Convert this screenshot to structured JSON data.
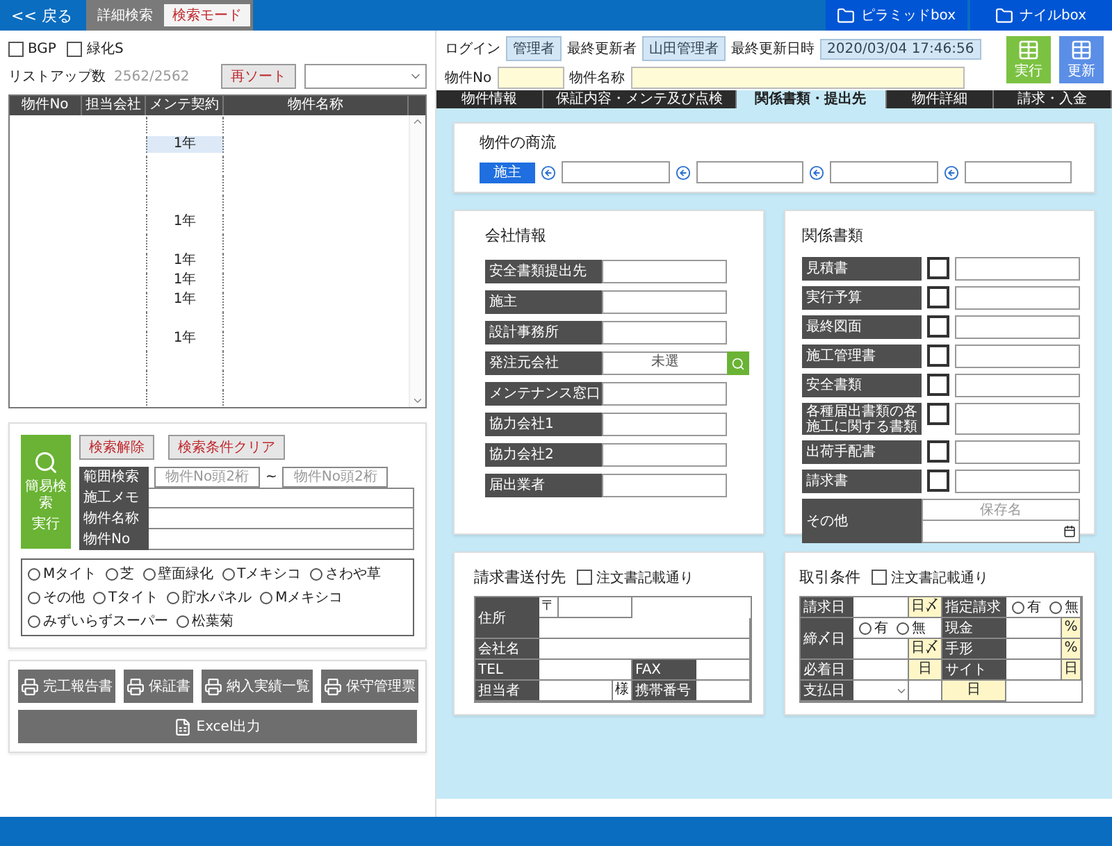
{
  "top_bar": {
    "back_link": "<< 戻る",
    "mode_tabs": [
      {
        "label": "詳細検索",
        "selected": false
      },
      {
        "label": "検索モード",
        "selected": true
      }
    ],
    "folder_buttons": [
      "ピラミッドbox",
      "ナイルbox"
    ]
  },
  "list_panel": {
    "filters": [
      {
        "label": "BGP",
        "checked": false
      },
      {
        "label": "緑化S",
        "checked": false
      }
    ],
    "count_label": "リストアップ数",
    "count": "2562/2562",
    "resort_button": "再ソート",
    "columns": [
      "物件No",
      "担当会社",
      "メンテ契約",
      "物件名称"
    ],
    "rows": [
      {
        "selected": false
      },
      {
        "contract": "1年",
        "selected": true
      },
      {
        "selected": false
      },
      {
        "selected": false
      },
      {
        "selected": false
      },
      {
        "contract": "1年",
        "selected": false
      },
      {
        "selected": false
      },
      {
        "contract": "1年",
        "selected": false
      },
      {
        "contract": "1年",
        "selected": false
      },
      {
        "contract": "1年",
        "selected": false
      },
      {
        "selected": false
      },
      {
        "contract": "1年",
        "selected": false
      },
      {
        "selected": false
      },
      {
        "selected": false
      },
      {
        "selected": false
      }
    ]
  },
  "search_panel": {
    "run_button": [
      "簡易検索",
      "実行"
    ],
    "clear_buttons": [
      "検索解除",
      "検索条件クリア"
    ],
    "range": {
      "label": "範囲検索",
      "from_placeholder": "物件No頭2桁",
      "separator": "~",
      "to_placeholder": "物件No頭2桁"
    },
    "fields": [
      {
        "label": "施工メモ"
      },
      {
        "label": "物件名称"
      },
      {
        "label": "物件No"
      }
    ],
    "types": [
      {
        "label": "Mタイト",
        "selected": false
      },
      {
        "label": "芝",
        "selected": false
      },
      {
        "label": "壁面緑化",
        "selected": false
      },
      {
        "label": "Tメキシコ",
        "selected": false
      },
      {
        "label": "さわや草",
        "selected": false
      },
      {
        "label": "その他",
        "selected": false
      },
      {
        "label": "Tタイト",
        "selected": false
      },
      {
        "label": "貯水パネル",
        "selected": false
      },
      {
        "label": "Mメキシコ",
        "selected": false
      },
      {
        "label": "みずいらずスーパー",
        "selected": false
      },
      {
        "label": "松葉菊",
        "selected": false
      }
    ]
  },
  "report_buttons": [
    "完工報告書",
    "保証書",
    "納入実績一覧",
    "保守管理票"
  ],
  "excel_button": "Excel出力",
  "header": {
    "info": [
      {
        "label": "ログイン",
        "value": "管理者"
      },
      {
        "label": "最終更新者",
        "value": "山田管理者"
      },
      {
        "label": "最終更新日時",
        "value": "2020/03/04 17:46:56"
      }
    ],
    "property_no_label": "物件No",
    "property_name_label": "物件名称",
    "action_buttons": [
      {
        "label": "実行",
        "color": "#7cc242"
      },
      {
        "label": "更新",
        "color": "#5b8ee6"
      }
    ]
  },
  "tabs": [
    {
      "label": "物件情報",
      "selected": false
    },
    {
      "label": "保証内容・メンテ及び点検",
      "selected": false
    },
    {
      "label": "関係書類・提出先",
      "selected": true
    },
    {
      "label": "物件詳細",
      "selected": false
    },
    {
      "label": "請求・入金",
      "selected": false
    }
  ],
  "commercial_flow": {
    "title": "物件の商流",
    "owner_button": "施主"
  },
  "company_info": {
    "title": "会社情報",
    "rows": [
      {
        "label": "安全書類提出先",
        "kind": "text"
      },
      {
        "label": "施主",
        "kind": "text"
      },
      {
        "label": "設計事務所",
        "kind": "text"
      },
      {
        "label": "発注元会社",
        "kind": "lookup",
        "value": "未選"
      },
      {
        "label": "メンテナンス窓口",
        "kind": "text"
      },
      {
        "label": "協力会社1",
        "kind": "text"
      },
      {
        "label": "協力会社2",
        "kind": "text"
      },
      {
        "label": "届出業者",
        "kind": "text"
      }
    ]
  },
  "documents": {
    "title": "関係書類",
    "rows": [
      {
        "label": "見積書",
        "checked": false
      },
      {
        "label": "実行予算",
        "checked": false
      },
      {
        "label": "最終図面",
        "checked": false
      },
      {
        "label": "施工管理書",
        "checked": false
      },
      {
        "label": "安全書類",
        "checked": false
      },
      {
        "label": "各種届出書類の各施工に関する書類",
        "checked": false
      },
      {
        "label": "出荷手配書",
        "checked": false
      },
      {
        "label": "請求書",
        "checked": false
      }
    ],
    "other": {
      "label": "その他",
      "placeholder": "保存名"
    }
  },
  "billing_address": {
    "title": "請求書送付先",
    "same_as_order": {
      "label": "注文書記載通り",
      "checked": false
    },
    "address": "住所",
    "postal_mark": "〒",
    "company": "会社名",
    "tel": "TEL",
    "fax": "FAX",
    "contact": "担当者",
    "honorific": "様",
    "mobile": "携帯番号"
  },
  "terms": {
    "title": "取引条件",
    "same_as_order": {
      "label": "注文書記載通り",
      "checked": false
    },
    "billing_day": "請求日",
    "billing_unit": "日〆",
    "designated": "指定請求",
    "designated_options": [
      {
        "label": "有",
        "selected": false
      },
      {
        "label": "無",
        "selected": false
      }
    ],
    "closing_day": "締〆日",
    "closing_options": [
      {
        "label": "有",
        "selected": false
      },
      {
        "label": "無",
        "selected": false
      }
    ],
    "closing_unit": "日〆",
    "cash": "現金",
    "cash_unit": "%",
    "bill": "手形",
    "bill_unit": "%",
    "arrival": "必着日",
    "arrival_unit": "日",
    "site": "サイト",
    "site_unit": "日",
    "payment": "支払日",
    "payment_unit": "日"
  }
}
